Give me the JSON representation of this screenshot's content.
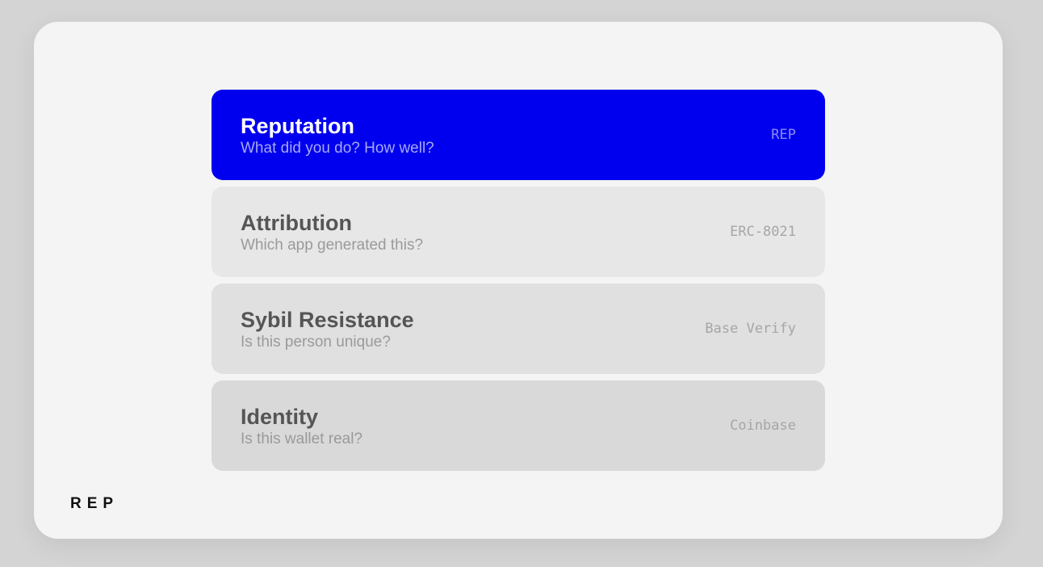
{
  "layers": [
    {
      "title": "Reputation",
      "subtitle": "What did you do? How well?",
      "tag": "REP"
    },
    {
      "title": "Attribution",
      "subtitle": "Which app generated this?",
      "tag": "ERC-8021"
    },
    {
      "title": "Sybil Resistance",
      "subtitle": "Is this person unique?",
      "tag": "Base Verify"
    },
    {
      "title": "Identity",
      "subtitle": "Is this wallet real?",
      "tag": "Coinbase"
    }
  ],
  "brand": "REP",
  "colors": {
    "accent": "#0000ee",
    "background": "#d4d4d4",
    "card": "#f4f4f4"
  }
}
